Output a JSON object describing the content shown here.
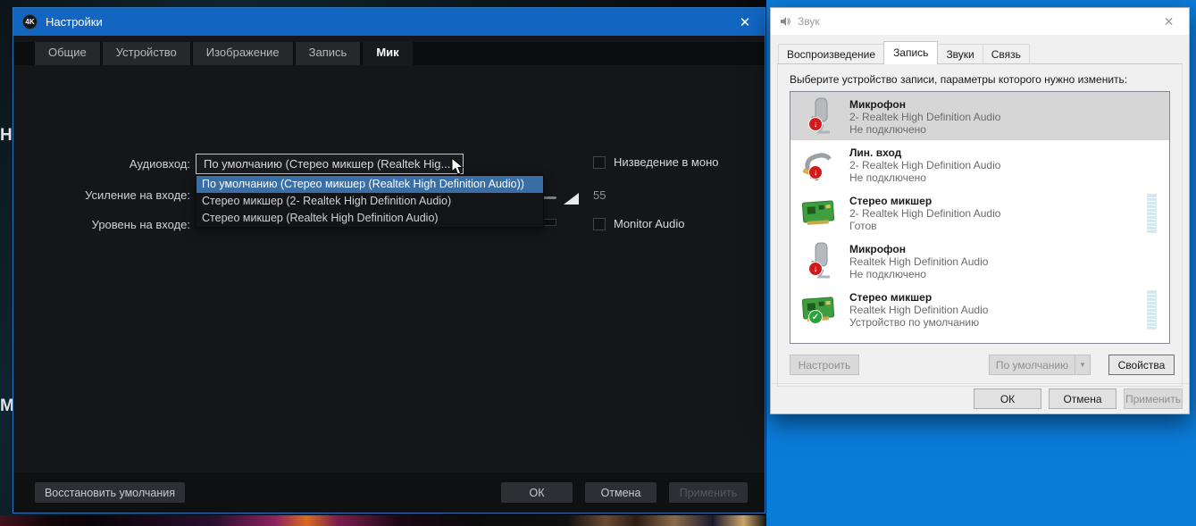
{
  "backdrop": {
    "text_top": "НИ",
    "text_bottom": "М"
  },
  "settings_window": {
    "title": "Настройки",
    "app_icon_text": "4K",
    "close_glyph": "✕",
    "tabs": [
      "Общие",
      "Устройство",
      "Изображение",
      "Запись",
      "Мик"
    ],
    "active_tab": "Мик",
    "audio_input_label": "Аудиовход:",
    "audio_input_value": "По умолчанию (Стерео микшер (Realtek Hig...",
    "combo_chevron": "∨",
    "dropdown_options": [
      "По умолчанию (Стерео микшер (Realtek High Definition Audio))",
      "Стерео микшер (2- Realtek High Definition Audio)",
      "Стерео микшер (Realtek High Definition Audio)"
    ],
    "gain_label": "Усиление на входе:",
    "gain_value": "55",
    "level_label": "Уровень на входе:",
    "mono_checkbox_label": "Низведение в моно",
    "monitor_checkbox_label": "Monitor Audio",
    "restore_button": "Восстановить умолчания",
    "ok_button": "ОК",
    "cancel_button": "Отмена",
    "apply_button": "Применить"
  },
  "sound_window": {
    "title": "Звук",
    "close_glyph": "✕",
    "tabs": [
      "Воспроизведение",
      "Запись",
      "Звуки",
      "Связь"
    ],
    "active_tab": "Запись",
    "instruction": "Выберите устройство записи, параметры которого нужно изменить:",
    "devices": [
      {
        "name": "Микрофон",
        "device": "2- Realtek High Definition Audio",
        "status": "Не подключено"
      },
      {
        "name": "Лин. вход",
        "device": "2- Realtek High Definition Audio",
        "status": "Не подключено"
      },
      {
        "name": "Стерео микшер",
        "device": "2- Realtek High Definition Audio",
        "status": "Готов"
      },
      {
        "name": "Микрофон",
        "device": "Realtek High Definition Audio",
        "status": "Не подключено"
      },
      {
        "name": "Стерео микшер",
        "device": "Realtek High Definition Audio",
        "status": "Устройство по умолчанию"
      }
    ],
    "configure_button": "Настроить",
    "default_button": "По умолчанию",
    "default_arrow": "▼",
    "properties_button": "Свойства",
    "ok_button": "ОК",
    "cancel_button": "Отмена",
    "apply_button": "Применить"
  },
  "colors": {
    "titlebar_blue": "#1266c2",
    "desktop_blue": "#0b7bd8",
    "dropdown_highlight": "#3a6ea5",
    "status_red": "#cf1b1b",
    "status_green": "#27a53b"
  }
}
